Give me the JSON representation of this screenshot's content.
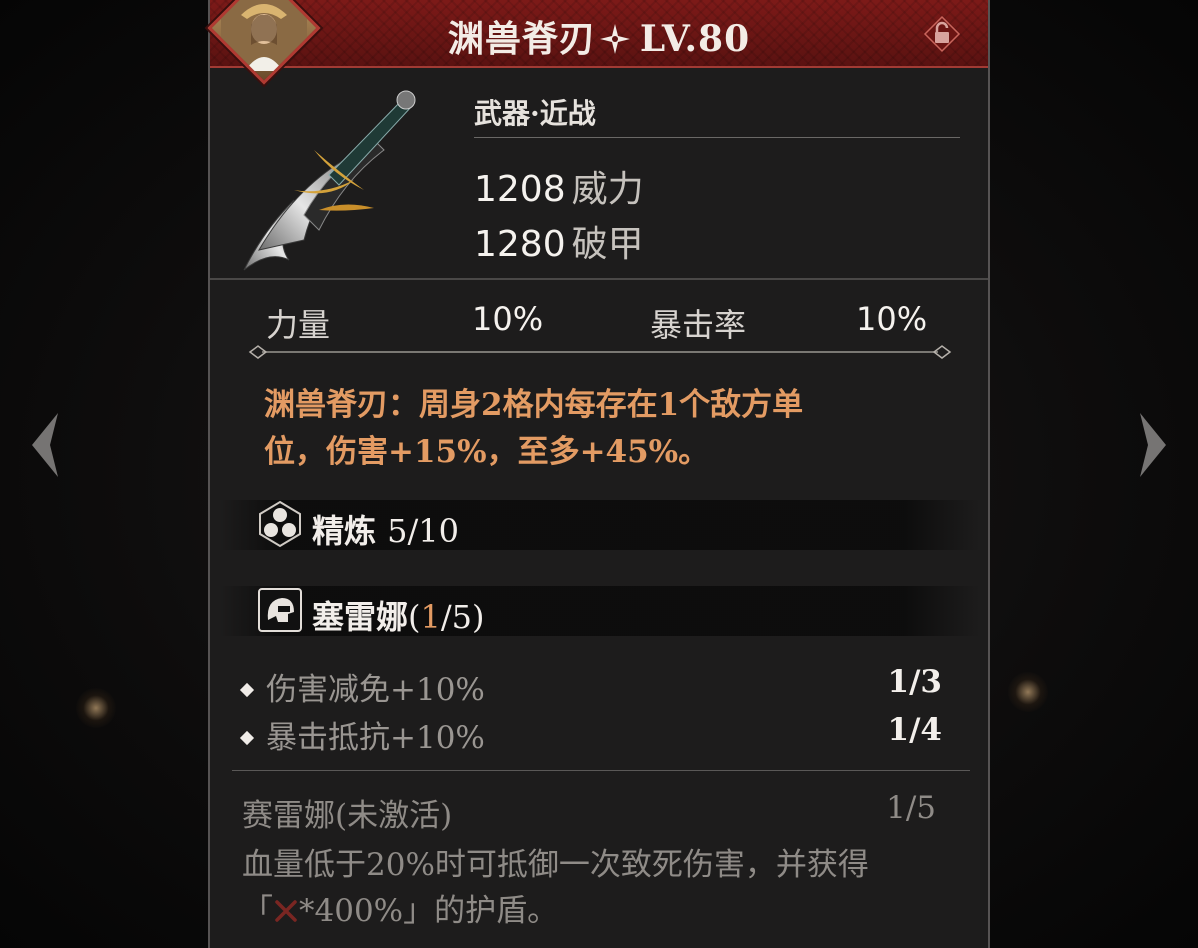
{
  "item": {
    "name": "渊兽脊刃",
    "level": "LV.80",
    "category": "武器·近战",
    "stats": [
      {
        "value": "1208",
        "label": "威力"
      },
      {
        "value": "1280",
        "label": "破甲"
      }
    ],
    "sub_stats": [
      {
        "label": "力量",
        "value": "10%"
      },
      {
        "label": "暴击率",
        "value": "10%"
      }
    ],
    "effect_line1": "渊兽脊刃：周身2格内每存在1个敌方单",
    "effect_line2": "位，伤害+15%，至多+45%。"
  },
  "refine": {
    "label": "精炼",
    "value": "5/10"
  },
  "set": {
    "name": "塞雷娜",
    "paren_open": "(",
    "current": "1",
    "total_suffix": "/5)",
    "bonuses": [
      {
        "text": "伤害减免+10%",
        "count": "1/3"
      },
      {
        "text": "暴击抵抗+10%",
        "count": "1/4"
      }
    ],
    "inactive_title": "赛雷娜(未激活)",
    "inactive_count": "1/5",
    "desc_line1": "血量低于20%时可抵御一次致死伤害，并获得",
    "desc_line2_pre": "「",
    "desc_line2_post": "*400%」的护盾。"
  },
  "colors": {
    "title_bar": "#7d1a18",
    "effect_text": "#e39b63",
    "panel_bg": "#1d1c1c"
  },
  "icons": {
    "star": "four-point-star-icon",
    "lock": "lock-icon",
    "refine": "refine-cluster-icon",
    "set": "helmet-icon",
    "attack": "crossed-swords-icon"
  }
}
